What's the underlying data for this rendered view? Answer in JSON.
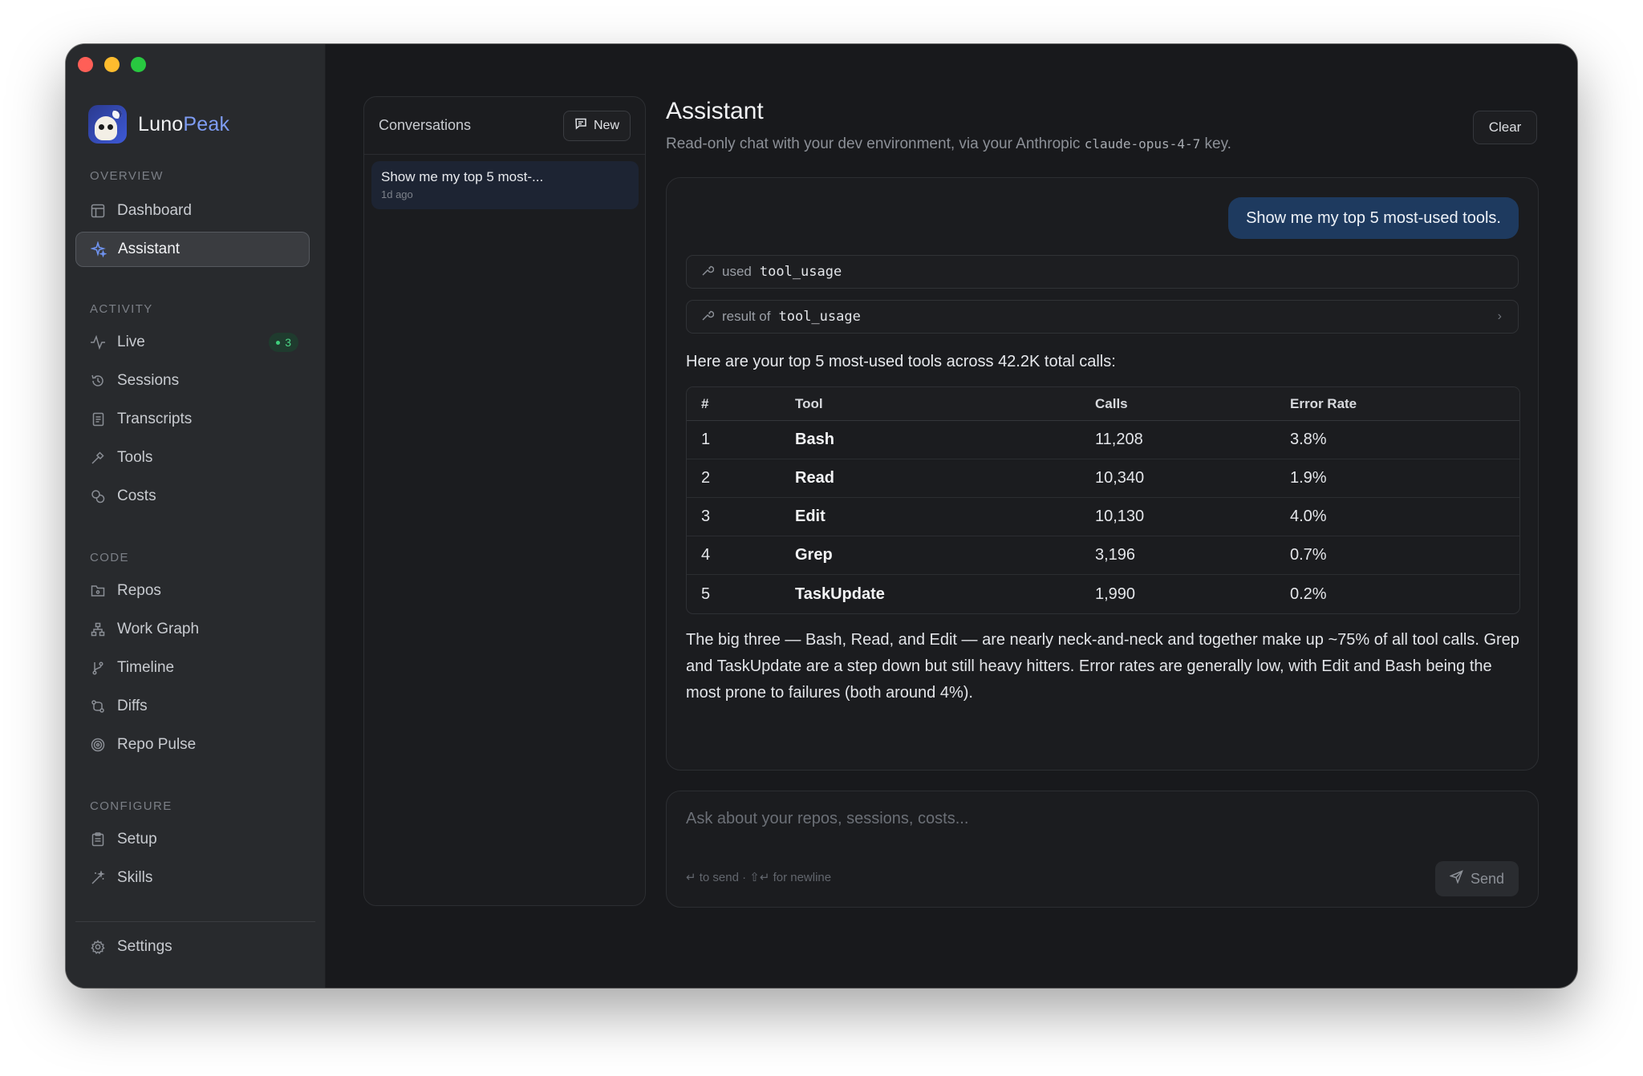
{
  "app": {
    "brand_first": "Luno",
    "brand_second": "Peak"
  },
  "sidebar": {
    "overview_label": "OVERVIEW",
    "overview_items": [
      {
        "label": "Dashboard",
        "icon": "layout-icon"
      },
      {
        "label": "Assistant",
        "icon": "sparkle-icon",
        "active": true
      }
    ],
    "activity_label": "ACTIVITY",
    "activity_items": [
      {
        "label": "Live",
        "icon": "pulse-icon",
        "badge": "3"
      },
      {
        "label": "Sessions",
        "icon": "history-icon"
      },
      {
        "label": "Transcripts",
        "icon": "scroll-icon"
      },
      {
        "label": "Tools",
        "icon": "hammer-icon"
      },
      {
        "label": "Costs",
        "icon": "coins-icon"
      }
    ],
    "code_label": "CODE",
    "code_items": [
      {
        "label": "Repos",
        "icon": "folder-git-icon"
      },
      {
        "label": "Work Graph",
        "icon": "network-icon"
      },
      {
        "label": "Timeline",
        "icon": "git-branch-icon"
      },
      {
        "label": "Diffs",
        "icon": "git-compare-icon"
      },
      {
        "label": "Repo Pulse",
        "icon": "radar-icon"
      }
    ],
    "configure_label": "CONFIGURE",
    "configure_items": [
      {
        "label": "Setup",
        "icon": "clipboard-icon"
      },
      {
        "label": "Skills",
        "icon": "wand-icon"
      }
    ],
    "settings_label": "Settings"
  },
  "conversations": {
    "title": "Conversations",
    "new_label": "New",
    "items": [
      {
        "title": "Show me my top 5 most-...",
        "time": "1d ago"
      }
    ]
  },
  "main": {
    "title": "Assistant",
    "subtitle_prefix": "Read-only chat with your dev environment, via your Anthropic ",
    "subtitle_code": "claude-opus-4-7",
    "subtitle_suffix": " key.",
    "clear_label": "Clear"
  },
  "chat": {
    "user_message": "Show me my top 5 most-used tools.",
    "tool_used_label": "used",
    "tool_used_name": "tool_usage",
    "tool_result_label": "result of",
    "tool_result_name": "tool_usage",
    "intro": "Here are your top 5 most-used tools across 42.2K total calls:",
    "table": {
      "headers": [
        "#",
        "Tool",
        "Calls",
        "Error Rate"
      ],
      "rows": [
        [
          "1",
          "Bash",
          "11,208",
          "3.8%"
        ],
        [
          "2",
          "Read",
          "10,340",
          "1.9%"
        ],
        [
          "3",
          "Edit",
          "10,130",
          "4.0%"
        ],
        [
          "4",
          "Grep",
          "3,196",
          "0.7%"
        ],
        [
          "5",
          "TaskUpdate",
          "1,990",
          "0.2%"
        ]
      ]
    },
    "summary": "The big three — Bash, Read, and Edit — are nearly neck-and-neck and together make up ~75% of all tool calls. Grep and TaskUpdate are a step down but still heavy hitters. Error rates are generally low, with Edit and Bash being the most prone to failures (both around 4%)."
  },
  "composer": {
    "placeholder": "Ask about your repos, sessions, costs...",
    "hint": "↵ to send · ⇧↵ for newline",
    "send_label": "Send"
  },
  "colors": {
    "accent": "#6f93f0",
    "user_bubble": "#1e3a5f",
    "live_badge": "#4bd384"
  }
}
